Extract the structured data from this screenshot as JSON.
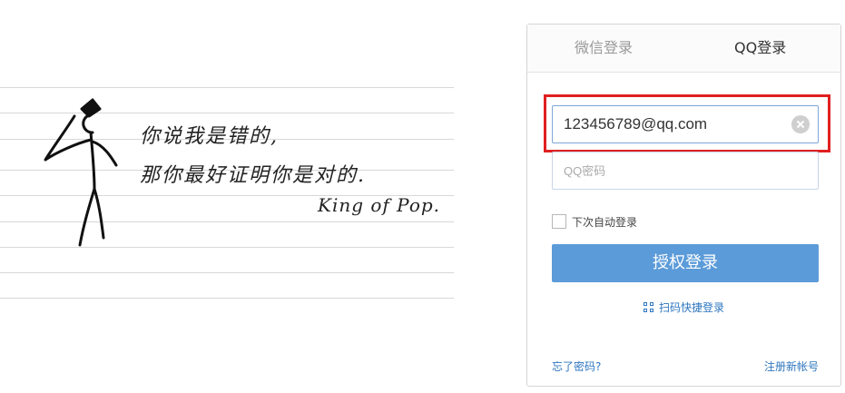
{
  "illustration": {
    "line1": "你说我是错的,",
    "line2": "那你最好证明你是对的.",
    "signature": "King of Pop."
  },
  "login": {
    "tabs": [
      {
        "label": "微信登录",
        "active": false
      },
      {
        "label": "QQ登录",
        "active": true
      }
    ],
    "username_value": "123456789@qq.com",
    "password_placeholder": "QQ密码",
    "remember_label": "下次自动登录",
    "submit_label": "授权登录",
    "qr_login_label": "扫码快捷登录",
    "forgot_label": "忘了密码?",
    "register_label": "注册新帐号",
    "colors": {
      "accent": "#5b9bd9",
      "link": "#2e76bf",
      "highlight": "#e02020"
    }
  }
}
